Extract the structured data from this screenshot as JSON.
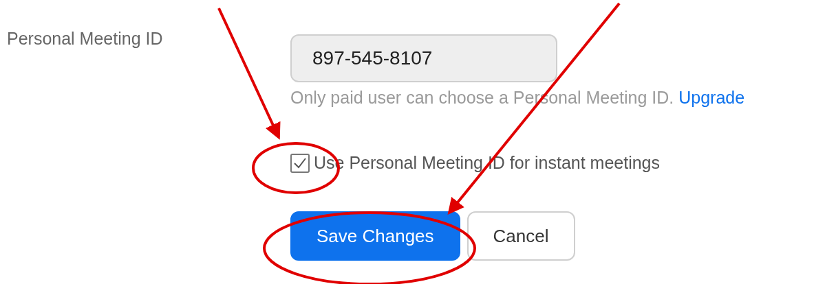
{
  "field": {
    "label": "Personal Meeting ID",
    "value": "897-545-8107",
    "disabled": true,
    "hint": "Only paid user can choose a Personal Meeting ID.",
    "hint_link": "Upgrade"
  },
  "checkbox": {
    "label": "Use Personal Meeting ID for instant meetings",
    "checked": true
  },
  "buttons": [
    {
      "label": "Save Changes",
      "kind": "primary"
    },
    {
      "label": "Cancel",
      "kind": "secondary"
    }
  ]
}
